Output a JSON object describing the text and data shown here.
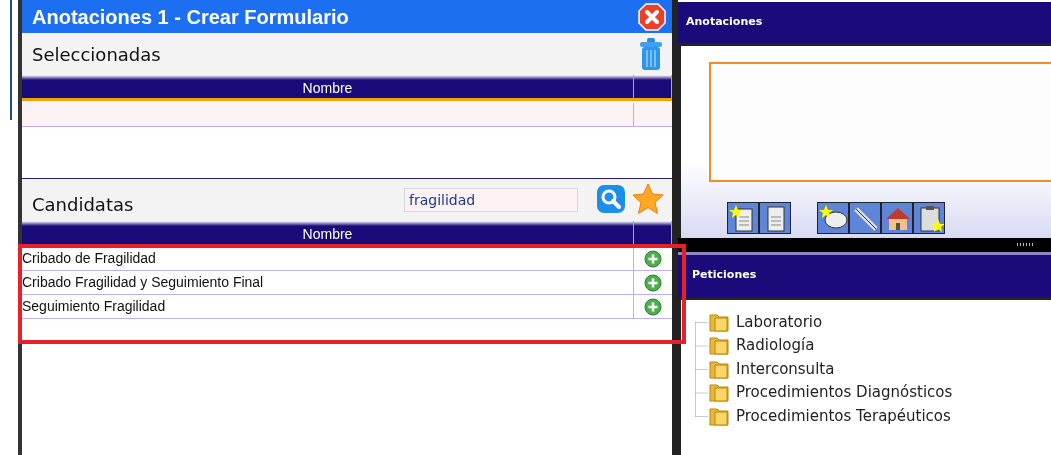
{
  "dialog": {
    "title": "Anotaciones 1 - Crear Formulario",
    "selected_section": {
      "label": "Seleccionadas",
      "columns": [
        "Nombre"
      ]
    },
    "candidates_section": {
      "label": "Candidatas",
      "search": {
        "value": "fragilidad"
      },
      "columns": [
        "Nombre"
      ],
      "rows": [
        {
          "name": "Cribado de Fragilidad"
        },
        {
          "name": "Cribado Fragilidad y Seguimiento Final"
        },
        {
          "name": "Seguimiento Fragilidad"
        }
      ]
    }
  },
  "annotations_panel": {
    "title": "Anotaciones"
  },
  "requests_panel": {
    "title": "Peticiones",
    "tree": [
      {
        "label": "Laboratorio"
      },
      {
        "label": "Radiología"
      },
      {
        "label": "Interconsulta"
      },
      {
        "label": "Procedimientos Diagnósticos"
      },
      {
        "label": "Procedimientos Terapéuticos"
      }
    ]
  }
}
